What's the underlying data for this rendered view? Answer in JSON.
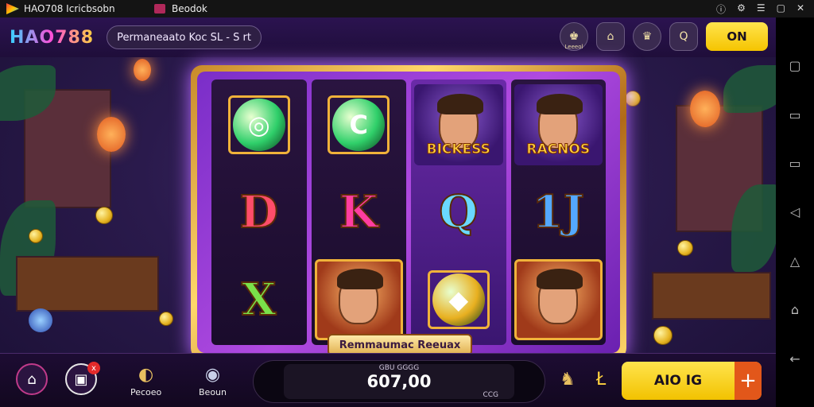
{
  "window": {
    "app_title": "HAO708 Icricbsobn",
    "tab_title": "Beodok",
    "controls": [
      "ⓘ",
      "⚙",
      "☰",
      "▢",
      "✕"
    ]
  },
  "header": {
    "brand": "HAO788",
    "title": "Permaneaato Koc SL - S rt"
  },
  "top_icons": [
    {
      "name": "gift-icon",
      "glyph": "♚",
      "sub": "Leeeol"
    },
    {
      "name": "home-icon",
      "glyph": "⌂"
    },
    {
      "name": "crown-icon",
      "glyph": "♛"
    },
    {
      "name": "search-icon",
      "glyph": "Q"
    }
  ],
  "on_button": "ON",
  "reels": [
    [
      {
        "kind": "gem",
        "text": "◎",
        "color": "#2fcf6a"
      },
      {
        "kind": "letter",
        "text": "D",
        "color": "#ff4d6a"
      },
      {
        "kind": "letter",
        "text": "X",
        "color": "#7ae04a"
      }
    ],
    [
      {
        "kind": "gem",
        "text": "C",
        "color": "#30d06a"
      },
      {
        "kind": "letter",
        "text": "K",
        "color": "#ff3da0"
      },
      {
        "kind": "character",
        "text": ""
      }
    ],
    [
      {
        "kind": "character-label",
        "text": "BICKESS"
      },
      {
        "kind": "letter",
        "text": "Q",
        "color": "#6ad8ff"
      },
      {
        "kind": "gem",
        "text": "◆",
        "color": "#e8b020"
      }
    ],
    [
      {
        "kind": "character-label",
        "text": "RACNOS"
      },
      {
        "kind": "letter",
        "text": "1J",
        "color": "#54a8ff"
      },
      {
        "kind": "character",
        "text": ""
      }
    ]
  ],
  "banner": "Remmaumac Reeuax",
  "bottom": {
    "home_label": "",
    "bag_badge": "x",
    "btn3_label": "Pecoeo",
    "btn4_label": "Beoun",
    "balance_top": "GBU GGGG",
    "balance_value": "607,00",
    "balance_sub": "CCG",
    "spin_label": "AIO IG",
    "plus": "+",
    "misc_icons": [
      "♞",
      "Ł"
    ]
  },
  "sidebar_icons": [
    "▢",
    "▭",
    "▭",
    "◁",
    "△",
    "⌂",
    "←"
  ]
}
